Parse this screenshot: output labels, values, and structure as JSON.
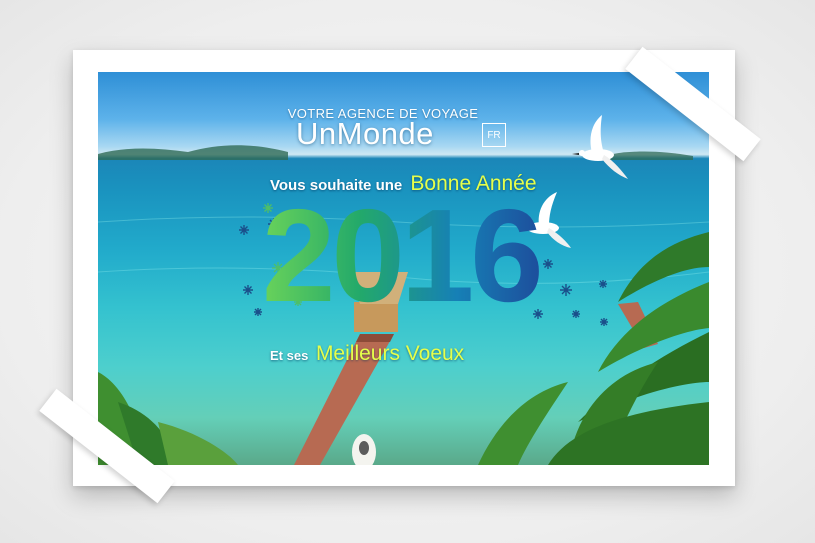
{
  "brand": {
    "tagline": "VOTRE AGENCE DE VOYAGE",
    "name": "UnMonde",
    "badge": "FR"
  },
  "greeting": {
    "line1_prefix": "Vous souhaite une",
    "line1_highlight": "Bonne Année",
    "year": "2016",
    "line2_prefix": "Et ses",
    "line2_highlight": "Meilleurs Voeux"
  },
  "colors": {
    "accent_yellow": "#e6ff4a",
    "year_green": "#3bbf5a",
    "year_blue": "#1d4e9c",
    "sea": "#21aacb"
  },
  "icons": [
    "bird-icon",
    "snowflake-icon",
    "palm-tree-icon",
    "jetty-icon",
    "boat-icon"
  ]
}
